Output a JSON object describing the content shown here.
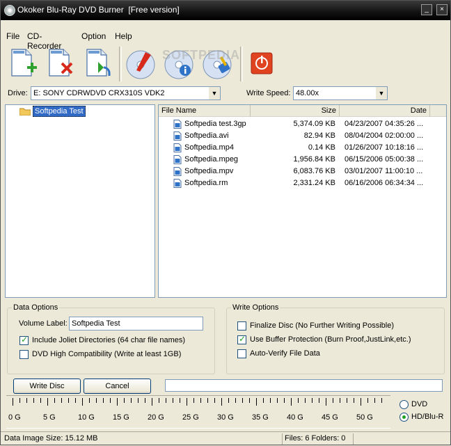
{
  "window": {
    "title": "Okoker Blu-Ray DVD Burner  [Free version]",
    "minimize": "_",
    "close": "×"
  },
  "menu": {
    "file": "File",
    "cd_recorder": "CD-Recorder",
    "option": "Option",
    "help": "Help"
  },
  "toolbar": {
    "buttons": [
      {
        "icon": "add-file-icon"
      },
      {
        "icon": "remove-file-icon"
      },
      {
        "icon": "import-file-icon"
      },
      {
        "icon": "burn-disc-icon"
      },
      {
        "icon": "disc-info-icon"
      },
      {
        "icon": "erase-disc-icon"
      },
      {
        "icon": "power-icon"
      }
    ],
    "watermark": "SOFTPEDIA"
  },
  "drive": {
    "label": "Drive:",
    "value": "E: SONY CDRWDVD CRX310S VDK2"
  },
  "write_speed": {
    "label": "Write Speed:",
    "value": "48.00x"
  },
  "tree": {
    "root": "Softpedia Test"
  },
  "files": {
    "columns": [
      "File Name",
      "Size",
      "Date"
    ],
    "rows": [
      {
        "name": "Softpedia test.3gp",
        "size": "5,374.09 KB",
        "date": "04/23/2007 04:35:26 ..."
      },
      {
        "name": "Softpedia.avi",
        "size": "82.94 KB",
        "date": "08/04/2004 02:00:00 ..."
      },
      {
        "name": "Softpedia.mp4",
        "size": "0.14 KB",
        "date": "01/26/2007 10:18:16 ..."
      },
      {
        "name": "Softpedia.mpeg",
        "size": "1,956.84 KB",
        "date": "06/15/2006 05:00:38 ..."
      },
      {
        "name": "Softpedia.mpv",
        "size": "6,083.76 KB",
        "date": "03/01/2007 11:00:10 ..."
      },
      {
        "name": "Softpedia.rm",
        "size": "2,331.24 KB",
        "date": "06/16/2006 06:34:34 ..."
      }
    ]
  },
  "data_options": {
    "title": "Data Options",
    "volume_label": "Volume Label:",
    "volume_value": "Softpedia Test",
    "joliet": {
      "label": "Include Joliet Directories (64 char file names)",
      "checked": true
    },
    "dvd_compat": {
      "label": "DVD High Compatibility (Write at least 1GB)",
      "checked": false
    }
  },
  "write_options": {
    "title": "Write Options",
    "finalize": {
      "label": "Finalize Disc (No Further Writing Possible)",
      "checked": false
    },
    "buffer": {
      "label": "Use Buffer Protection (Burn Proof,JustLink,etc.)",
      "checked": true
    },
    "verify": {
      "label": "Auto-Verify File Data",
      "checked": false
    }
  },
  "buttons": {
    "write_disc": "Write Disc",
    "cancel": "Cancel"
  },
  "progress": {
    "fraction": 0
  },
  "ruler": {
    "labels": [
      "0 G",
      "5 G",
      "10 G",
      "15 G",
      "20 G",
      "25 G",
      "30 G",
      "35 G",
      "40 G",
      "45 G",
      "50 G"
    ]
  },
  "disc_type": {
    "dvd": "DVD",
    "hd": "HD/Blu-R",
    "selected": "hd"
  },
  "status": {
    "image_size": "Data Image Size: 15.12 MB",
    "counts": "Files: 6  Folders: 0"
  },
  "colors": {
    "titlebar": "#000000",
    "selection": "#316ac5",
    "check_green": "#21a121"
  }
}
